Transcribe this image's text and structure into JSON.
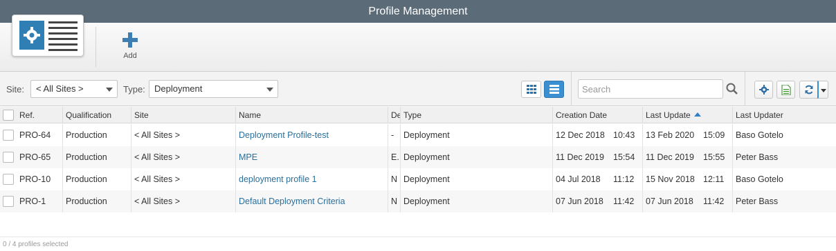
{
  "window": {
    "title": "Profile Management"
  },
  "toolbar": {
    "add_label": "Add"
  },
  "filters": {
    "site_label": "Site:",
    "site_value": "< All Sites >",
    "type_label": "Type:",
    "type_value": "Deployment",
    "search_placeholder": "Search"
  },
  "colors": {
    "accent": "#3a8fd1",
    "titlebar": "#5b6b78",
    "link": "#2a6f9b"
  },
  "table": {
    "columns": [
      "Ref.",
      "Qualification",
      "Site",
      "Name",
      "De",
      "Type",
      "Creation Date",
      "Last Update",
      "Last Updater"
    ],
    "sorted_column": "Last Update",
    "sort_direction": "ascending",
    "rows": [
      {
        "ref": "PRO-64",
        "qualification": "Production",
        "site": "< All Sites >",
        "name": "Deployment Profile-test",
        "de": "-",
        "type": "Deployment",
        "created_date": "12 Dec 2018",
        "created_time": "10:43",
        "updated_date": "13 Feb 2020",
        "updated_time": "15:09",
        "updater": "Baso Gotelo"
      },
      {
        "ref": "PRO-65",
        "qualification": "Production",
        "site": "< All Sites >",
        "name": "MPE",
        "de": "E.",
        "type": "Deployment",
        "created_date": "11 Dec 2019",
        "created_time": "15:54",
        "updated_date": "11 Dec 2019",
        "updated_time": "15:55",
        "updater": "Peter Bass"
      },
      {
        "ref": "PRO-10",
        "qualification": "Production",
        "site": "< All Sites >",
        "name": "deployment profile 1",
        "de": "N",
        "type": "Deployment",
        "created_date": "04 Jul 2018",
        "created_time": "11:12",
        "updated_date": "15 Nov 2018",
        "updated_time": "12:11",
        "updater": "Baso Gotelo"
      },
      {
        "ref": "PRO-1",
        "qualification": "Production",
        "site": "< All Sites >",
        "name": "Default Deployment Criteria",
        "de": "N",
        "type": "Deployment",
        "created_date": "07 Jun 2018",
        "created_time": "11:42",
        "updated_date": "07 Jun 2018",
        "updated_time": "11:42",
        "updater": "Peter Bass"
      }
    ]
  },
  "status": {
    "selection_text": "0 / 4 profiles selected"
  }
}
